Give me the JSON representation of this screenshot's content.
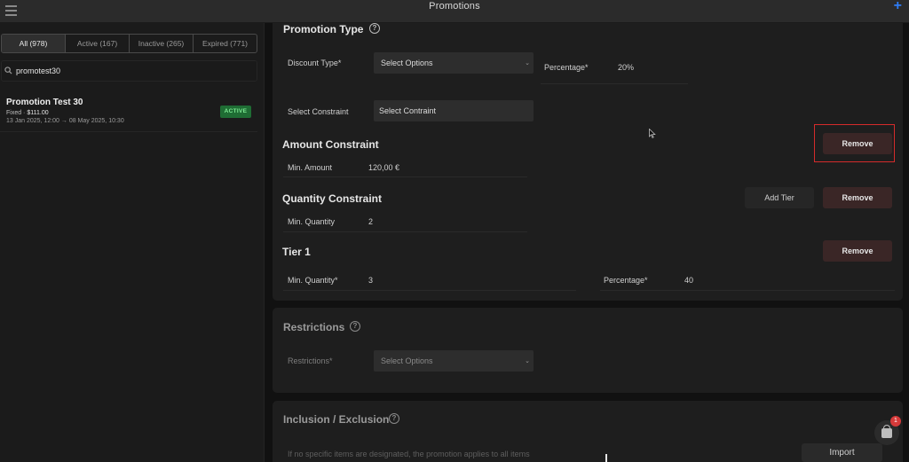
{
  "app": {
    "title": "Promotions"
  },
  "sidebar": {
    "tabs": [
      {
        "label": "All (978)"
      },
      {
        "label": "Active (167)"
      },
      {
        "label": "Inactive (265)"
      },
      {
        "label": "Expired (771)"
      }
    ],
    "search": {
      "value": "promotest30"
    },
    "promotions": [
      {
        "name": "Promotion Test 30",
        "fixed_prefix": "Fixed · ",
        "amount": "$111.00",
        "dates": "13 Jan 2025, 12:00 → 08 May 2025, 10:30",
        "status": "ACTIVE"
      }
    ]
  },
  "promotion_type": {
    "heading": "Promotion Type",
    "discount_type_label": "Discount Type*",
    "discount_type_value": "Select Options",
    "percentage_label": "Percentage*",
    "percentage_value": "20%",
    "select_constraint_label": "Select Constraint",
    "select_constraint_value": "Select Contraint"
  },
  "amount_constraint": {
    "heading": "Amount Constraint",
    "remove_label": "Remove",
    "min_amount_label": "Min. Amount",
    "min_amount_value": "120,00 €"
  },
  "quantity_constraint": {
    "heading": "Quantity Constraint",
    "add_tier_label": "Add Tier",
    "remove_label": "Remove",
    "min_quantity_label": "Min. Quantity",
    "min_quantity_value": "2"
  },
  "tier1": {
    "heading": "Tier 1",
    "remove_label": "Remove",
    "min_quantity_label": "Min. Quantity*",
    "min_quantity_value": "3",
    "percentage_label": "Percentage*",
    "percentage_value": "40"
  },
  "restrictions": {
    "heading": "Restrictions",
    "label": "Restrictions*",
    "value": "Select Options"
  },
  "inclusion": {
    "heading": "Inclusion / Exclusion",
    "note": "If no specific items are designated, the promotion applies to all items",
    "import_label": "Import"
  },
  "cart": {
    "count": "1"
  },
  "colors": {
    "accent": "#2f7df6",
    "active_badge": "#1f6d34",
    "remove_button": "#3a2626",
    "highlight": "#d42b2b"
  }
}
